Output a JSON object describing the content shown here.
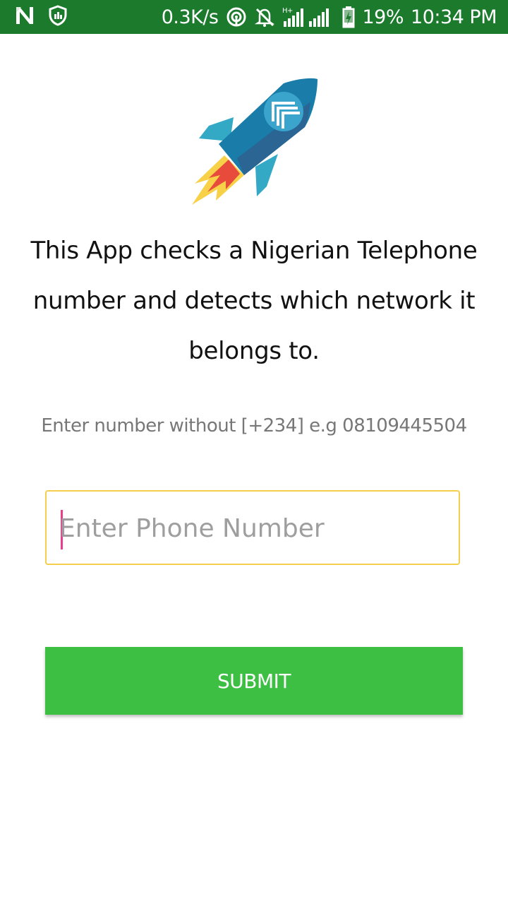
{
  "status_bar": {
    "speed": "0.3K/s",
    "network_type": "H+",
    "battery_percent": "19%",
    "time": "10:34 PM",
    "icons": [
      "n-app-icon",
      "shield-icon",
      "hotspot-icon",
      "mute-icon",
      "signal-icon",
      "battery-icon"
    ],
    "background": "#1b7a2c"
  },
  "main": {
    "logo_icon": "rocket-icon",
    "description": "This App checks a Nigerian Telephone number and detects which network it belongs to.",
    "hint": "Enter number without [+234] e.g 08109445504",
    "phone_input": {
      "value": "",
      "placeholder": "Enter Phone Number"
    },
    "submit_label": "SUBMIT"
  },
  "colors": {
    "accent": "#3dbf44",
    "input_border": "#f5cf4b",
    "cursor": "#e83e8c"
  }
}
